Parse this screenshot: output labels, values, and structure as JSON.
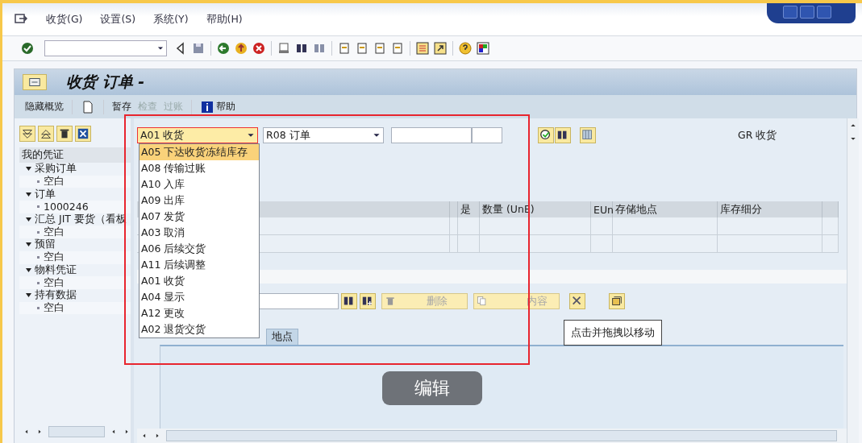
{
  "menu_bar": {
    "items": [
      "收货(G)",
      "设置(S)",
      "系统(Y)",
      "帮助(H)"
    ]
  },
  "title": "收货 订单 -",
  "app_toolbar": {
    "hide_overview": "隐藏概览",
    "actions": [
      {
        "label": "暂存",
        "disabled": false
      },
      {
        "label": "检查",
        "disabled": true
      },
      {
        "label": "过账",
        "disabled": true
      }
    ],
    "help": "帮助"
  },
  "sidebar": {
    "heading": "我的凭证",
    "tree": [
      {
        "label": "采购订单",
        "expanded": true,
        "children": [
          {
            "label": "空白"
          }
        ]
      },
      {
        "label": "订单",
        "expanded": true,
        "children": [
          {
            "label": "1000246"
          }
        ]
      },
      {
        "label": "汇总 JIT 要货（看板",
        "expanded": true,
        "children": [
          {
            "label": "空白"
          }
        ]
      },
      {
        "label": "预留",
        "expanded": true,
        "children": [
          {
            "label": "空白"
          }
        ]
      },
      {
        "label": "物料凭证",
        "expanded": true,
        "children": [
          {
            "label": "空白"
          }
        ]
      },
      {
        "label": "持有数据",
        "expanded": true,
        "children": [
          {
            "label": "空白"
          }
        ]
      }
    ]
  },
  "header": {
    "action": {
      "value": "A01 收货",
      "options": [
        {
          "label": "A05 下达收货冻结库存",
          "highlighted": true
        },
        {
          "label": "A08 传输过账",
          "highlighted": false
        },
        {
          "label": "A10 入库",
          "highlighted": false
        },
        {
          "label": "A09 出库",
          "highlighted": false
        },
        {
          "label": "A07 发货",
          "highlighted": false
        },
        {
          "label": "A03 取消",
          "highlighted": false
        },
        {
          "label": "A06 后续交货",
          "highlighted": false
        },
        {
          "label": "A11 后续调整",
          "highlighted": false
        },
        {
          "label": "A01 收货",
          "highlighted": false
        },
        {
          "label": "A04 显示",
          "highlighted": false
        },
        {
          "label": "A12 更改",
          "highlighted": false
        },
        {
          "label": "A02 退货交货",
          "highlighted": false
        }
      ]
    },
    "reference": {
      "value": "R08 订单"
    },
    "title": "GR 收货"
  },
  "table": {
    "columns": [
      "是",
      "数量 (UnE)",
      "EUn",
      "存储地点",
      "库存细分"
    ]
  },
  "detail": {
    "buttons": [
      {
        "label": "删除",
        "disabled": true
      },
      {
        "label": "内容",
        "disabled": true
      }
    ],
    "tabs": [
      {
        "label": "地点",
        "selected": false
      }
    ]
  },
  "tooltip": "点击并拖拽以移动",
  "edit_badge": "编辑"
}
